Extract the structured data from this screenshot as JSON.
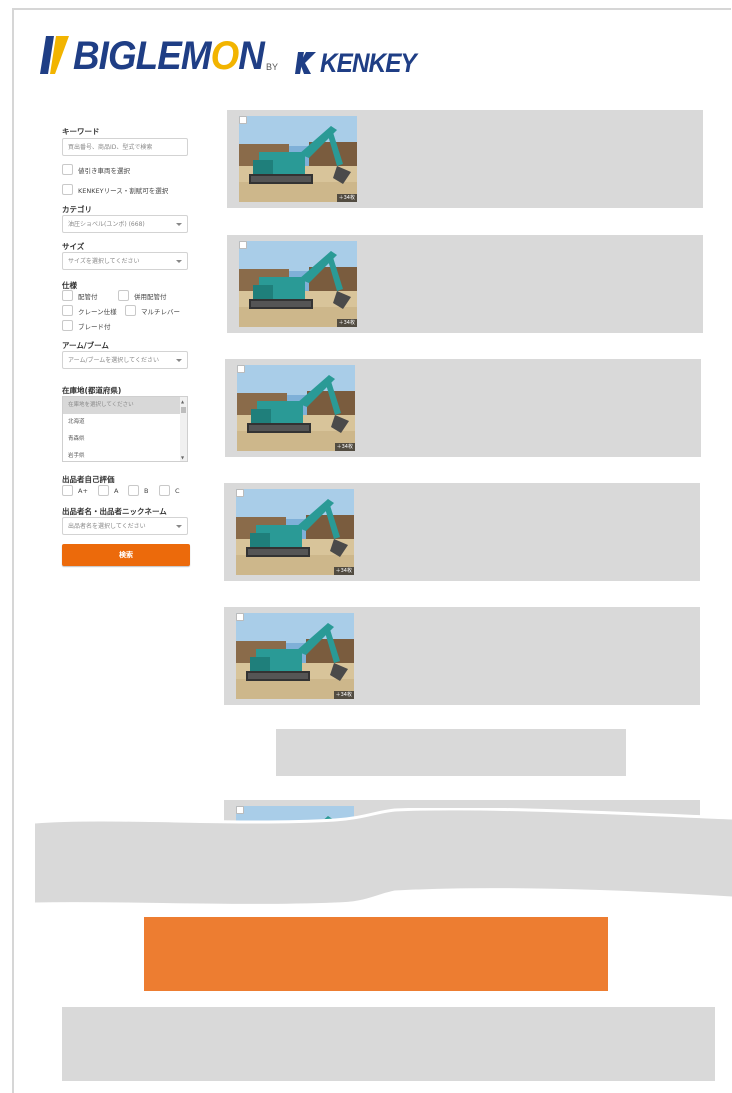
{
  "brand": {
    "logo_main": "BIGLEMON",
    "logo_by": "BY",
    "logo_partner": "KENKEY",
    "colors": {
      "navy": "#1f3e85",
      "yellow": "#f2b400",
      "orange": "#ec6a0b",
      "placeholder_gray": "#d9d9d9",
      "block_orange": "#ed7d31"
    }
  },
  "search": {
    "keyword_label": "キーワード",
    "keyword_placeholder": "買出番号、商品ID、型式で検索",
    "discount_checkbox": "値引き車両を選択",
    "kenkey_checkbox": "KENKEYリース・割賦可を選択",
    "category_label": "カテゴリ",
    "category_value": "油圧ショベル(ユンボ) (668)",
    "size_label": "サイズ",
    "size_value": "サイズを選択してください",
    "spec_label": "仕様",
    "spec_options": [
      "配管付",
      "併用配管付",
      "クレーン仕様",
      "マルチレバー",
      "ブレード付"
    ],
    "arm_label": "アーム/ブーム",
    "arm_value": "アーム/ブームを選択してください",
    "location_label": "在庫地(都道府県)",
    "location_options": [
      "在庫地を選択してください",
      "北海道",
      "青森県",
      "岩手県"
    ],
    "rating_label": "出品者自己評価",
    "rating_options": [
      "A+",
      "A",
      "B",
      "C"
    ],
    "seller_label": "出品者名・出品者ニックネーム",
    "seller_value": "出品者名を選択してください",
    "search_button": "検索"
  },
  "listings": [
    {
      "photos": "＋34枚",
      "icon": "excavator-photo"
    },
    {
      "photos": "＋34枚",
      "icon": "excavator-photo"
    },
    {
      "photos": "＋34枚",
      "icon": "excavator-photo"
    },
    {
      "photos": "＋34枚",
      "icon": "excavator-photo"
    },
    {
      "photos": "＋34枚",
      "icon": "excavator-photo"
    }
  ]
}
